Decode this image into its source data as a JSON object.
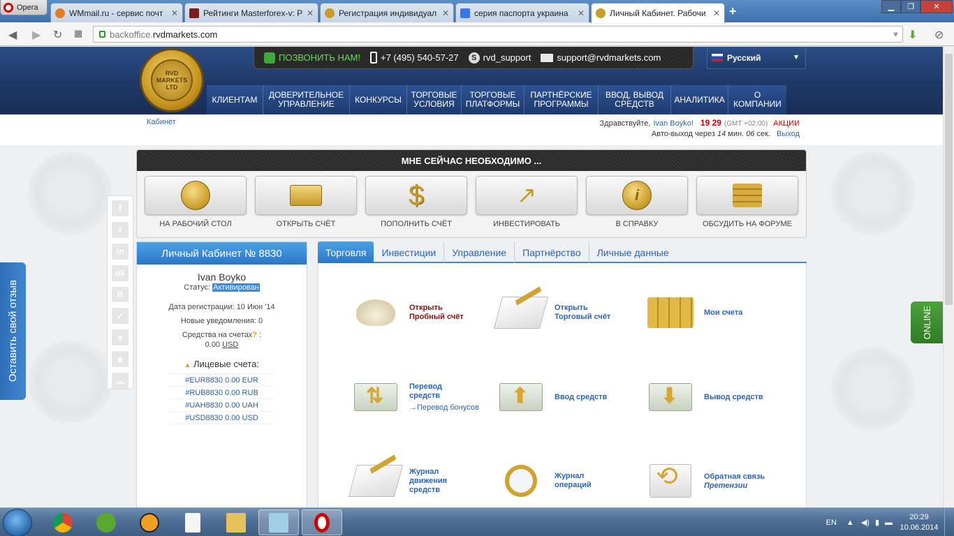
{
  "browser": {
    "menu_label": "Opera",
    "tabs": [
      {
        "title": "WMmail.ru - сервис почт",
        "color": "#e67b1e"
      },
      {
        "title": "Рейтинги Masterforex-v: Р",
        "color": "#7a1c1c"
      },
      {
        "title": "Регистрация индивидуал",
        "color": "#c99b27"
      },
      {
        "title": "серия паспорта украина",
        "color": "#3b78e7"
      },
      {
        "title": "Личный Кабинет. Рабочи",
        "color": "#c99b27"
      }
    ],
    "url_host_prefix": "backoffice.",
    "url_host": "rvdmarkets.com",
    "new_tab": "+",
    "win_min": "▁",
    "win_max": "❐",
    "win_close": "✕"
  },
  "header": {
    "call_label": "ПОЗВОНИТЬ НАМ!",
    "phone": "+7 (495) 540-57-27",
    "skype": "rvd_support",
    "email": "support@rvdmarkets.com",
    "language": "Русский",
    "logo_text": "RVD MARKETS LTD",
    "nav": [
      "КЛИЕНТАМ",
      "ДОВЕРИТЕЛЬНОЕ УПРАВЛЕНИЕ",
      "КОНКУРСЫ",
      "ТОРГОВЫЕ УСЛОВИЯ",
      "ТОРГОВЫЕ ПЛАТФОРМЫ",
      "ПАРТНЁРСКИЕ ПРОГРАММЫ",
      "ВВОД, ВЫВОД СРЕДСТВ",
      "АНАЛИТИКА",
      "О КОМПАНИИ"
    ]
  },
  "subheader": {
    "breadcrumb": "Кабинет",
    "greeting": "Здравствуйте,",
    "user": "Ivan Boyko!",
    "time": "19 29",
    "gmt": "(GMT +02:00)",
    "promo": "АКЦИИ",
    "autoexit_prefix": "Авто-выход через",
    "autoexit_min": "14",
    "autoexit_min_label": "мин.",
    "autoexit_sec": "06",
    "autoexit_sec_label": "сек.",
    "logout": "Выход"
  },
  "need": {
    "title": "МНЕ СЕЙЧАС НЕОБХОДИМО ...",
    "items": [
      "НА РАБОЧИЙ СТОЛ",
      "ОТКРЫТЬ СЧЁТ",
      "ПОПОЛНИТЬ СЧЁТ",
      "ИНВЕСТИРОВАТЬ",
      "В СПРАВКУ",
      "ОБСУДИТЬ НА ФОРУМЕ"
    ]
  },
  "cabinet": {
    "title": "Личный Кабинет № 8830",
    "name": "Ivan Boyko",
    "status_label": "Статус:",
    "status_value": "Активирован",
    "reg_label": "Дата регистрации:",
    "reg_value": "10 Июн '14",
    "notif_label": "Новые уведомления:",
    "notif_value": "0",
    "funds_label": "Средства на счетах",
    "funds_value": "0.00",
    "funds_currency": "USD",
    "accounts_title": "Лицевые счета:",
    "accounts": [
      "#EUR8830  0.00 EUR",
      "#RUB8830  0.00 RUB",
      "#UAH8830  0.00 UAH",
      "#USD8830  0.00 USD"
    ]
  },
  "tabs": [
    "Торговля",
    "Инвестиции",
    "Управление",
    "Партнёрство",
    "Личные данные"
  ],
  "trade": {
    "demo": "Открыть Пробный счёт",
    "open_trade": "Открыть Торговый счёт",
    "my_accounts": "Мои счета",
    "transfer": "Перевод средств",
    "transfer_bonus": "Перевод бонусов",
    "deposit": "Ввод средств",
    "withdraw": "Вывод средств",
    "journal_funds": "Журнал движения средств",
    "journal_ops": "Журнал операций",
    "feedback": "Обратная связь",
    "claims": "Претензии"
  },
  "side": {
    "feedback": "Оставить свой отзыв",
    "online": "ONLINE",
    "social": [
      "f",
      "t",
      "in",
      "ok",
      "B",
      "✓",
      "✦",
      "★",
      "︽"
    ]
  },
  "taskbar": {
    "lang": "EN",
    "time": "20:29",
    "date": "10.06.2014"
  }
}
